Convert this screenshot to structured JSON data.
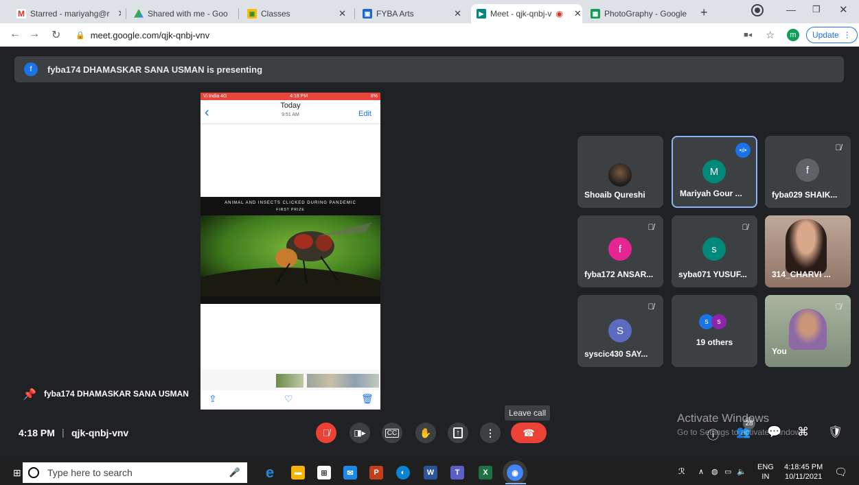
{
  "browser": {
    "tabs": [
      {
        "label": "Starred - mariyahg@r",
        "icon": "gmail-icon",
        "color": "#ffffff"
      },
      {
        "label": "Shared with me - Goo",
        "icon": "drive-icon",
        "color": "#ffffff"
      },
      {
        "label": "Classes",
        "icon": "classroom-icon",
        "color": "#ffffff"
      },
      {
        "label": "FYBA Arts",
        "icon": "classroom-icon",
        "color": "#ffffff"
      },
      {
        "label": "Meet - qjk-qnbj-v",
        "icon": "meet-icon",
        "color": "#ffffff",
        "active": true
      },
      {
        "label": "PhotoGraphy - Google",
        "icon": "sheets-icon",
        "color": "#ffffff"
      }
    ],
    "new_tab": "+",
    "url": "meet.google.com/qjk-qnbj-vnv",
    "update_label": "Update",
    "profile_initial": "m"
  },
  "presenting_banner": {
    "initial": "f",
    "text": "fyba174 DHAMASKAR SANA USMAN is presenting"
  },
  "phone_screen": {
    "carrier": "Vi India 4G",
    "time": "4:18 PM",
    "battery": "8%",
    "nav_title": "Today",
    "nav_subtitle": "9:51 AM",
    "edit_label": "Edit",
    "photo_caption": "ANIMAL AND INSECTS CLICKED DURING PANDEMIC",
    "photo_subcaption": "FIRST PRIZE"
  },
  "participants": [
    {
      "name": "Shoaib Qureshi",
      "initial": "",
      "color": "#3c4043",
      "muted": false
    },
    {
      "name": "Mariyah Gour ...",
      "initial": "M",
      "color": "#00897b",
      "muted": false,
      "speaking": true
    },
    {
      "name": "fyba029 SHAIK...",
      "initial": "f",
      "color": "#5f6368",
      "muted": true
    },
    {
      "name": "fyba172 ANSAR...",
      "initial": "f",
      "color": "#e52592",
      "muted": true
    },
    {
      "name": "syba071 YUSUF...",
      "initial": "s",
      "color": "#00897b",
      "muted": true
    },
    {
      "name": "314_CHARVI ...",
      "initial": "",
      "color": "#3c4043",
      "muted": false
    },
    {
      "name": "syscic430 SAY...",
      "initial": "S",
      "color": "#5c6bc0",
      "muted": true
    },
    {
      "name": "19 others",
      "initial": "s",
      "color": "#1a73e8",
      "muted": false
    },
    {
      "name": "You",
      "initial": "",
      "color": "#3c4043",
      "muted": true
    }
  ],
  "pinned_presenter": "fyba174 DHAMASKAR SANA USMAN",
  "meeting": {
    "time": "4:18 PM",
    "separator": "|",
    "code": "qjk-qnbj-vnv"
  },
  "tooltip": "Leave call",
  "participant_count": "28",
  "watermark": {
    "line1": "Activate Windows",
    "line2": "Go to Settings to activate Windows."
  },
  "taskbar": {
    "search_placeholder": "Type here to search",
    "lang": "ENG",
    "region": "IN",
    "clock_time": "4:18:45 PM",
    "clock_date": "10/11/2021"
  }
}
